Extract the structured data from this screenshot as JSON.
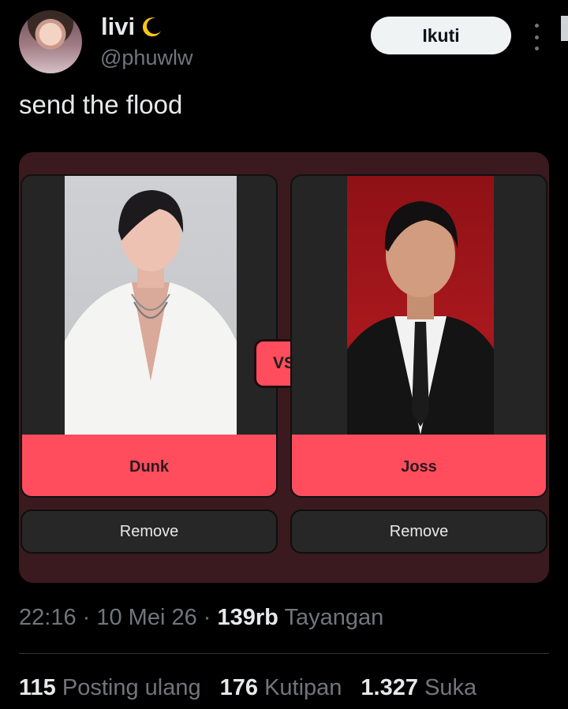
{
  "user": {
    "display_name": "livi",
    "handle": "@phuwlw",
    "name_emoji_icon": "crescent-moon-icon"
  },
  "header": {
    "follow_label": "Ikuti",
    "more_icon": "more-vertical-icon"
  },
  "tweet": {
    "text": "send the flood"
  },
  "matchup": {
    "vs_label": "VS",
    "left": {
      "name": "Dunk",
      "remove_label": "Remove"
    },
    "right": {
      "name": "Joss",
      "remove_label": "Remove"
    },
    "colors": {
      "accent": "#ff4d5e",
      "card_bg": "#3a1a1f",
      "panel_bg": "#252525"
    }
  },
  "meta": {
    "time": "22:16",
    "date": "10 Mei 26",
    "views_count": "139rb",
    "views_label": "Tayangan"
  },
  "stats": {
    "reposts_count": "115",
    "reposts_label": "Posting ulang",
    "quotes_count": "176",
    "quotes_label": "Kutipan",
    "likes_count": "1.327",
    "likes_label": "Suka"
  }
}
